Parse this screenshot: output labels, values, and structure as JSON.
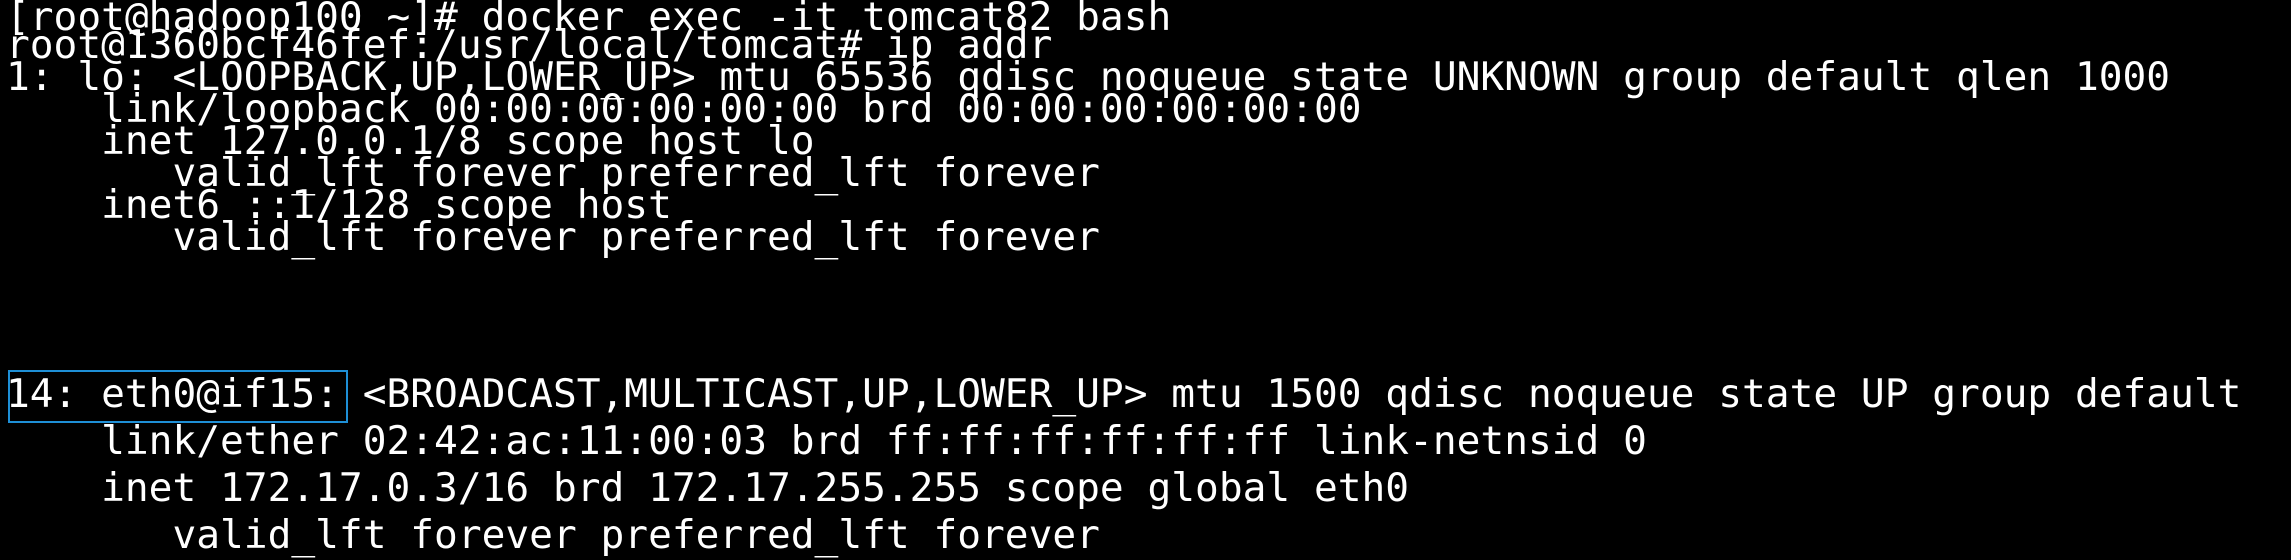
{
  "terminal": {
    "lines": [
      "[root@hadoop100 ~]# docker exec -it tomcat82 bash",
      "root@1360bcf46fef:/usr/local/tomcat# ip addr",
      "1: lo: <LOOPBACK,UP,LOWER_UP> mtu 65536 qdisc noqueue state UNKNOWN group default qlen 1000",
      "    link/loopback 00:00:00:00:00:00 brd 00:00:00:00:00:00",
      "    inet 127.0.0.1/8 scope host lo",
      "       valid_lft forever preferred_lft forever",
      "    inet6 ::1/128 scope host",
      "       valid_lft forever preferred_lft forever",
      "14: eth0@if15: <BROADCAST,MULTICAST,UP,LOWER_UP> mtu 1500 qdisc noqueue state UP group default",
      "    link/ether 02:42:ac:11:00:03 brd ff:ff:ff:ff:ff:ff link-netnsid 0",
      "    inet 172.17.0.3/16 brd 172.17.255.255 scope global eth0",
      "       valid_lft forever preferred_lft forever"
    ]
  },
  "colors": {
    "background": "#000000",
    "text": "#ffffff",
    "highlight_border": "#1e8fd6"
  }
}
